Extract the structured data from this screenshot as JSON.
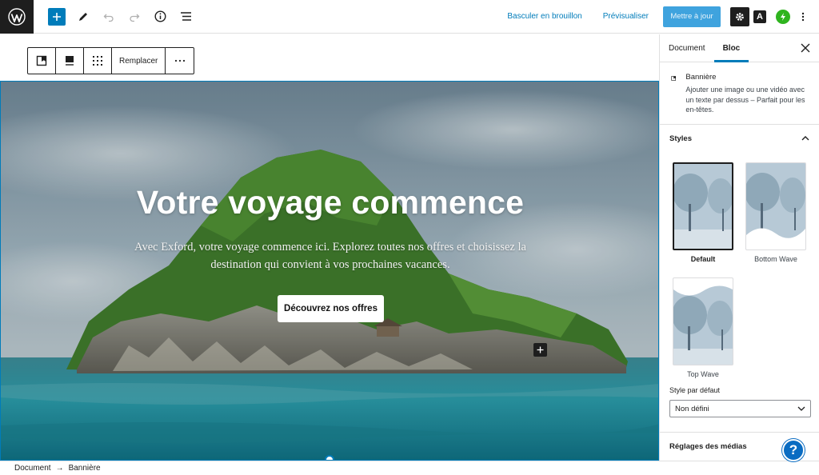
{
  "topbar": {
    "switch_draft": "Basculer en brouillon",
    "preview": "Prévisualiser",
    "update": "Mettre à jour",
    "a_label": "A"
  },
  "block_toolbar": {
    "replace": "Remplacer"
  },
  "cover": {
    "title": "Votre voyage commence",
    "text": "Avec Exford, votre voyage commence ici. Explorez toutes nos offres et choisissez la destination qui convient à vos prochaines vacances.",
    "button": "Découvrez nos offres"
  },
  "sidebar": {
    "tabs": [
      {
        "label": "Document"
      },
      {
        "label": "Bloc"
      }
    ],
    "block_card": {
      "title": "Bannière",
      "description": "Ajouter une image ou une vidéo avec un texte par dessus – Parfait pour les en-têtes."
    },
    "styles": {
      "title": "Styles",
      "options": [
        {
          "label": "Default"
        },
        {
          "label": "Bottom Wave"
        },
        {
          "label": "Top Wave"
        }
      ],
      "default_style_label": "Style par défaut",
      "default_style_value": "Non défini"
    },
    "media_panel": "Réglages des médias"
  },
  "breadcrumb": {
    "items": [
      "Document",
      "Bannière"
    ]
  },
  "help": {
    "label": "?"
  },
  "colors": {
    "accent": "#007cba",
    "dark": "#1e1e1e",
    "jetpack": "#2fb41f"
  }
}
